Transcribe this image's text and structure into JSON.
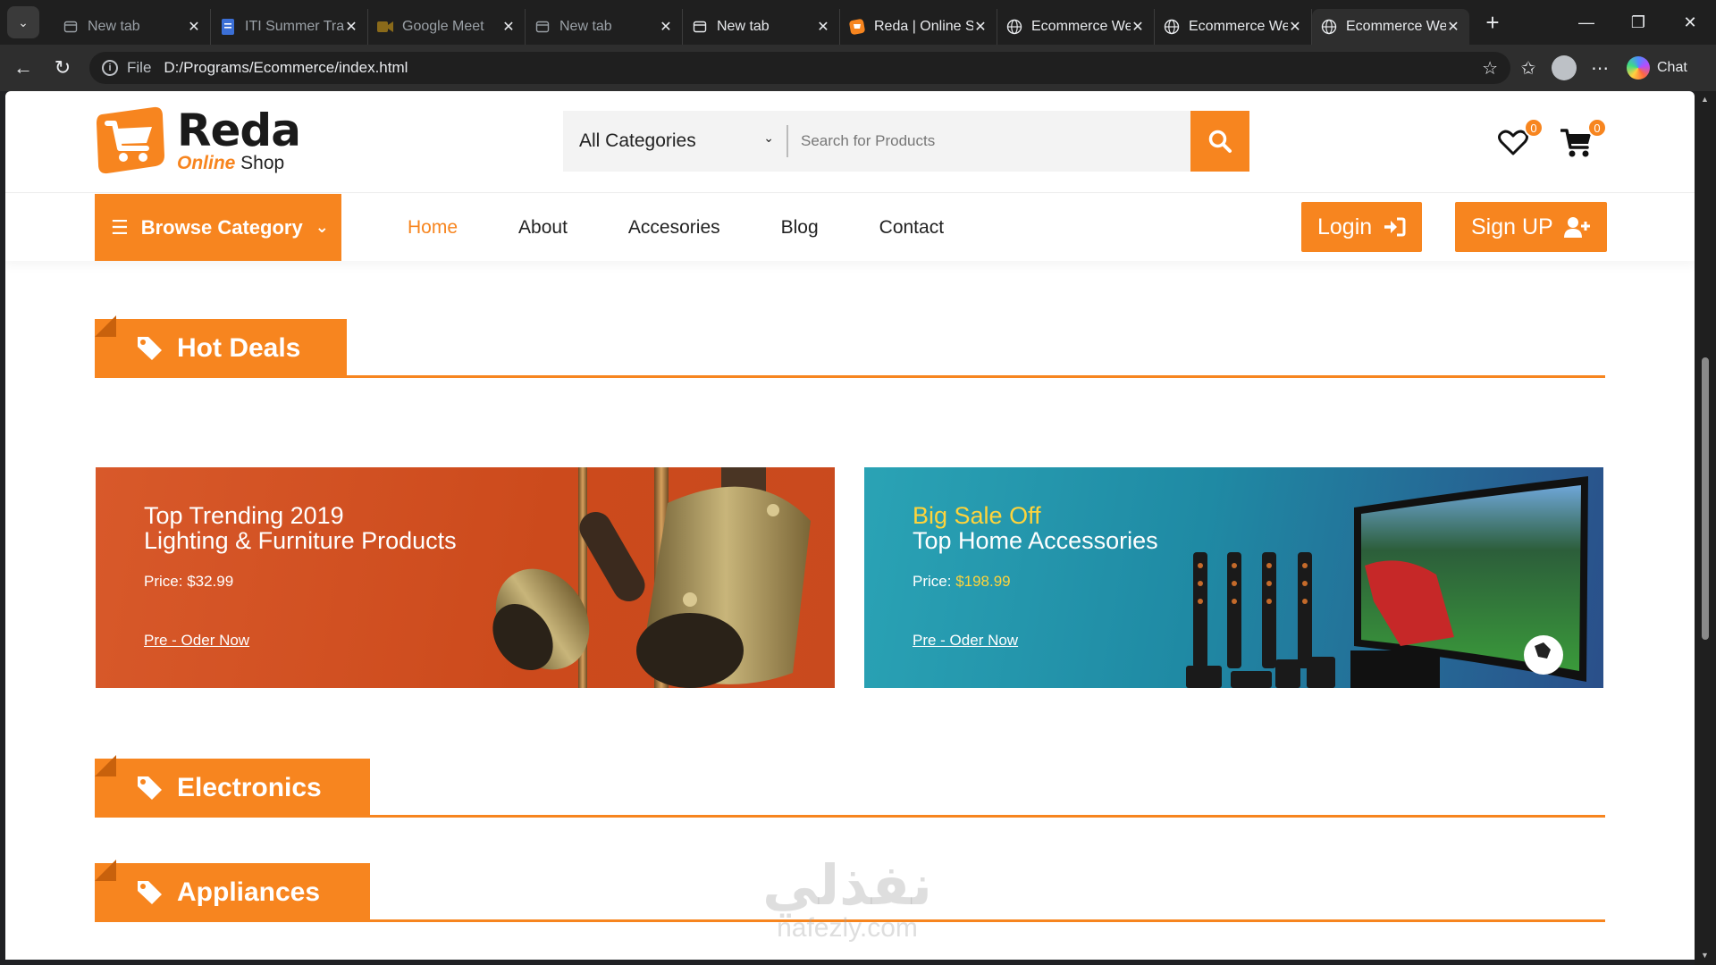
{
  "browser": {
    "tabs": [
      {
        "title": "New tab",
        "icon": "page-icon"
      },
      {
        "title": "ITI Summer Trai",
        "icon": "doc-icon"
      },
      {
        "title": "Google Meet",
        "icon": "meet-icon"
      },
      {
        "title": "New tab",
        "icon": "page-icon"
      },
      {
        "title": "New tab",
        "icon": "page-icon"
      },
      {
        "title": "Reda | Online St",
        "icon": "cart-icon"
      },
      {
        "title": "Ecommerce Wel",
        "icon": "globe-icon"
      },
      {
        "title": "Ecommerce Wel",
        "icon": "globe-icon"
      },
      {
        "title": "Ecommerce Wel",
        "icon": "globe-icon",
        "active": true
      }
    ],
    "address": {
      "scheme": "File",
      "url": "D:/Programs/Ecommerce/index.html"
    },
    "chat_label": "Chat"
  },
  "site": {
    "logo": {
      "name": "Reda",
      "tag_highlight": "Online",
      "tag_rest": " Shop"
    },
    "search": {
      "category": "All Categories",
      "placeholder": "Search for Products"
    },
    "wishlist_count": "0",
    "cart_count": "0",
    "browse_label": "Browse Category",
    "menu": [
      {
        "label": "Home",
        "active": true
      },
      {
        "label": "About"
      },
      {
        "label": "Accesories"
      },
      {
        "label": "Blog"
      },
      {
        "label": "Contact"
      }
    ],
    "login_label": "Login",
    "signup_label": "Sign UP"
  },
  "sections": {
    "hot_deals": "Hot Deals",
    "electronics": "Electronics",
    "appliances": "Appliances"
  },
  "banners": [
    {
      "line1": "Top Trending 2019",
      "line2": "Lighting & Furniture Products",
      "price_label": "Price: ",
      "price": "$32.99",
      "cta": "Pre - Oder Now"
    },
    {
      "line1": "Big Sale Off",
      "line2": "Top Home Accessories",
      "price_label": "Price: ",
      "price": "$198.99",
      "cta": "Pre - Oder Now"
    }
  ],
  "watermark": {
    "arabic": "نفذلي",
    "latin": "nafezly.com"
  },
  "colors": {
    "accent": "#f7851f",
    "banner1": "#d14f22",
    "banner2": "#1f8fa6"
  }
}
